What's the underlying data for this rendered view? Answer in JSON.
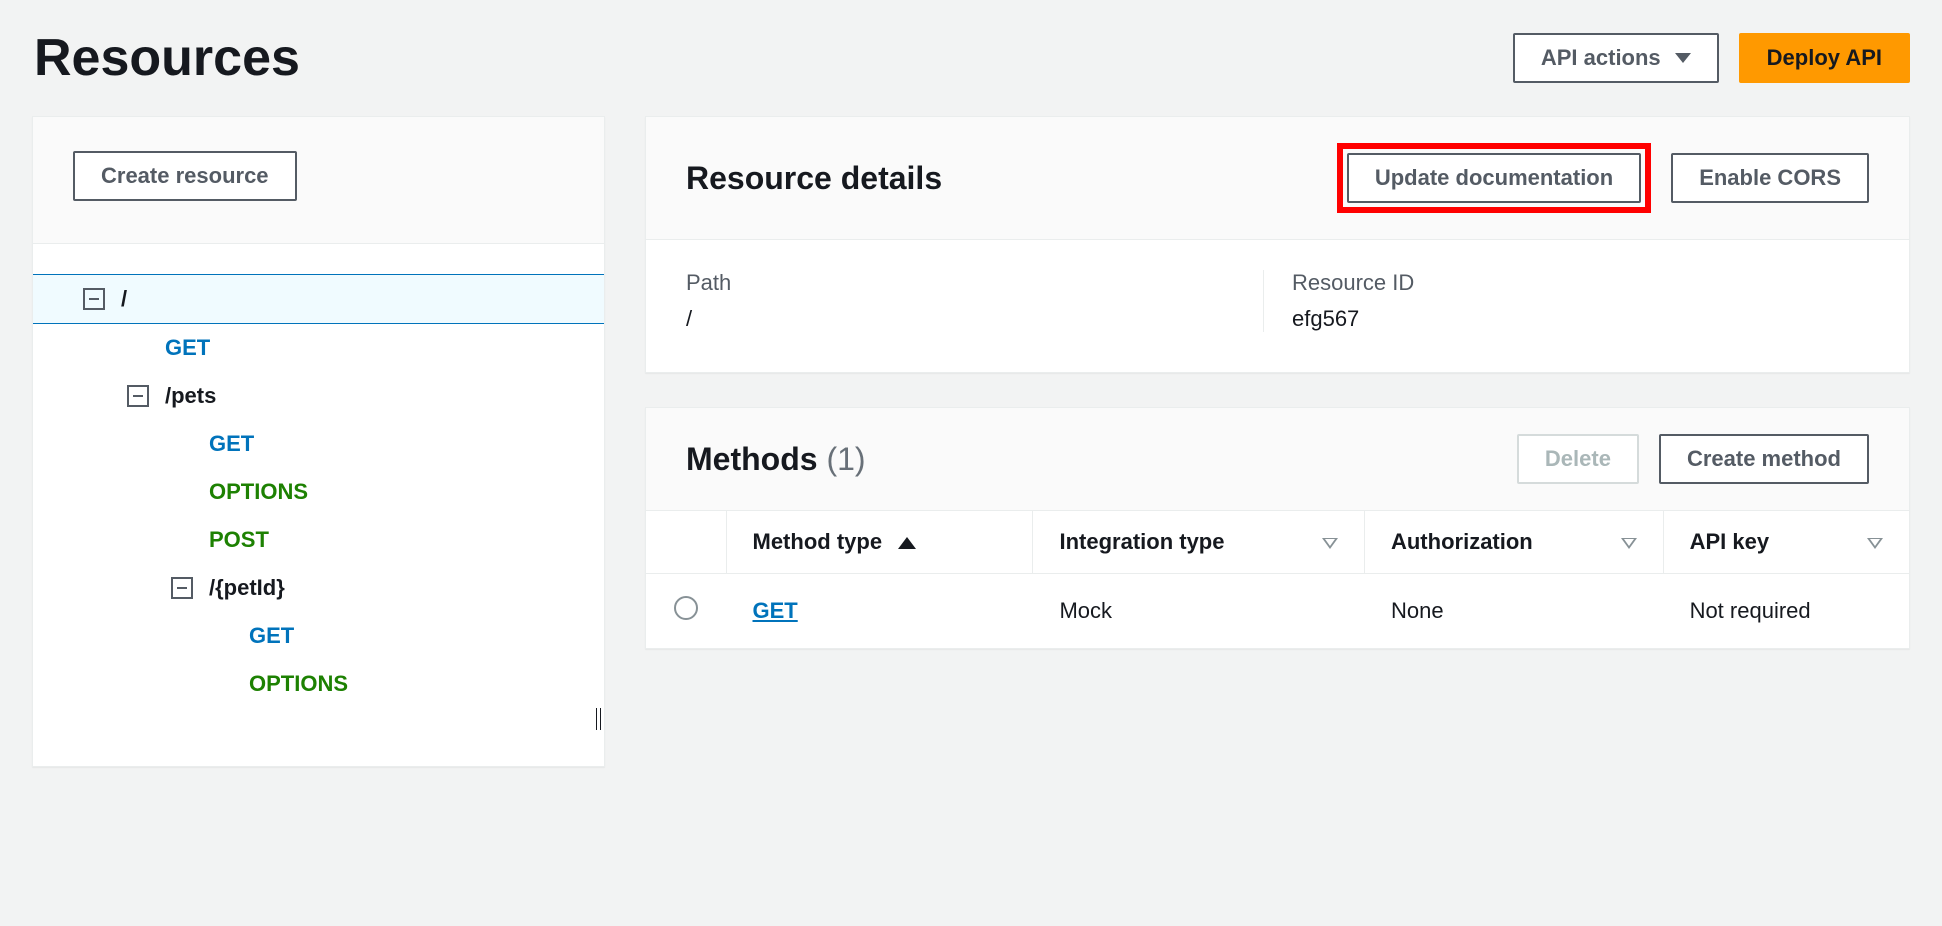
{
  "page_title": "Resources",
  "header_actions": {
    "api_actions": "API actions",
    "deploy_api": "Deploy API"
  },
  "sidebar": {
    "create_resource": "Create resource",
    "tree": {
      "root": "/",
      "root_get": "GET",
      "pets": "/pets",
      "pets_get": "GET",
      "pets_options": "OPTIONS",
      "pets_post": "POST",
      "petid": "/{petId}",
      "petid_get": "GET",
      "petid_options": "OPTIONS"
    }
  },
  "resource_details": {
    "title": "Resource details",
    "update_doc": "Update documentation",
    "enable_cors": "Enable CORS",
    "path_label": "Path",
    "path_value": "/",
    "id_label": "Resource ID",
    "id_value": "efg567"
  },
  "methods": {
    "title": "Methods",
    "count": "(1)",
    "delete": "Delete",
    "create": "Create method",
    "cols": {
      "method_type": "Method type",
      "integration_type": "Integration type",
      "authorization": "Authorization",
      "api_key": "API key"
    },
    "rows": [
      {
        "method": "GET",
        "integration": "Mock",
        "authorization": "None",
        "api_key": "Not required"
      }
    ]
  }
}
